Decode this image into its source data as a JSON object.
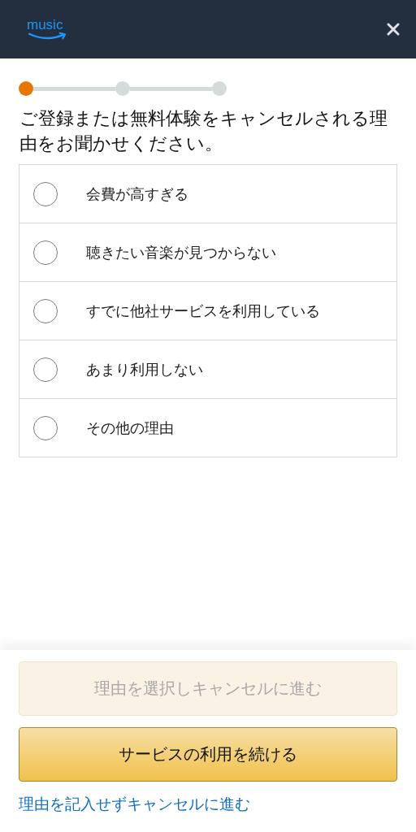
{
  "header": {
    "logo": "music"
  },
  "steps": [
    {
      "active": true
    },
    {
      "active": false
    },
    {
      "active": false
    }
  ],
  "question": "ご登録または無料体験をキャンセルされる理由をお聞かせください。",
  "options": [
    {
      "label": "会費が高すぎる",
      "selected": false
    },
    {
      "label": "聴きたい音楽が見つからない",
      "selected": false
    },
    {
      "label": "すでに他社サービスを利用している",
      "selected": false
    },
    {
      "label": "あまり利用しない",
      "selected": false
    },
    {
      "label": "その他の理由",
      "selected": false
    }
  ],
  "buttons": [
    {
      "label": "理由を選択しキャンセルに進む",
      "kind": "secondary",
      "disabled": true
    },
    {
      "label": "サービスの利用を続ける",
      "kind": "primary",
      "disabled": false
    }
  ],
  "link": "理由を記入せずキャンセルに進む"
}
